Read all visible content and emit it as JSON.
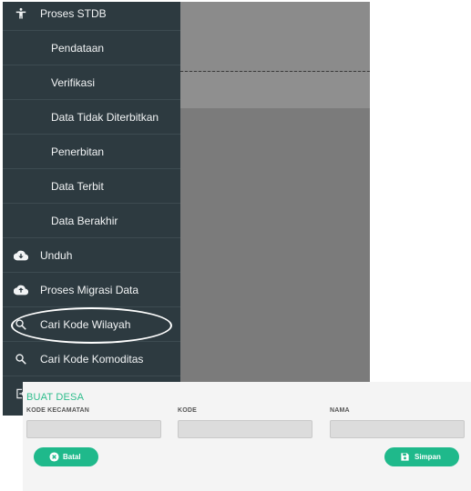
{
  "sidebar": {
    "items": [
      {
        "label": "Proses STDB",
        "icon": "accessibility-icon",
        "sub": false
      },
      {
        "label": "Pendataan",
        "sub": true
      },
      {
        "label": "Verifikasi",
        "sub": true
      },
      {
        "label": "Data Tidak Diterbitkan",
        "sub": true
      },
      {
        "label": "Penerbitan",
        "sub": true
      },
      {
        "label": "Data Terbit",
        "sub": true
      },
      {
        "label": "Data Berakhir",
        "sub": true
      },
      {
        "label": "Unduh",
        "icon": "cloud-download-icon",
        "sub": false
      },
      {
        "label": "Proses Migrasi Data",
        "icon": "cloud-upload-icon",
        "sub": false
      },
      {
        "label": "Cari Kode Wilayah",
        "icon": "search-icon",
        "sub": false
      },
      {
        "label": "Cari Kode Komoditas",
        "icon": "search-icon",
        "sub": false
      }
    ]
  },
  "form": {
    "title": "BUAT DESA",
    "fields": [
      {
        "label": "KODE KECAMATAN",
        "value": ""
      },
      {
        "label": "KODE",
        "value": ""
      },
      {
        "label": "NAMA",
        "value": ""
      }
    ],
    "cancel_label": "Batal",
    "save_label": "Simpan"
  },
  "colors": {
    "sidebar_bg": "#2d3a40",
    "accent": "#1fb98b",
    "title": "#2ebd8c"
  }
}
